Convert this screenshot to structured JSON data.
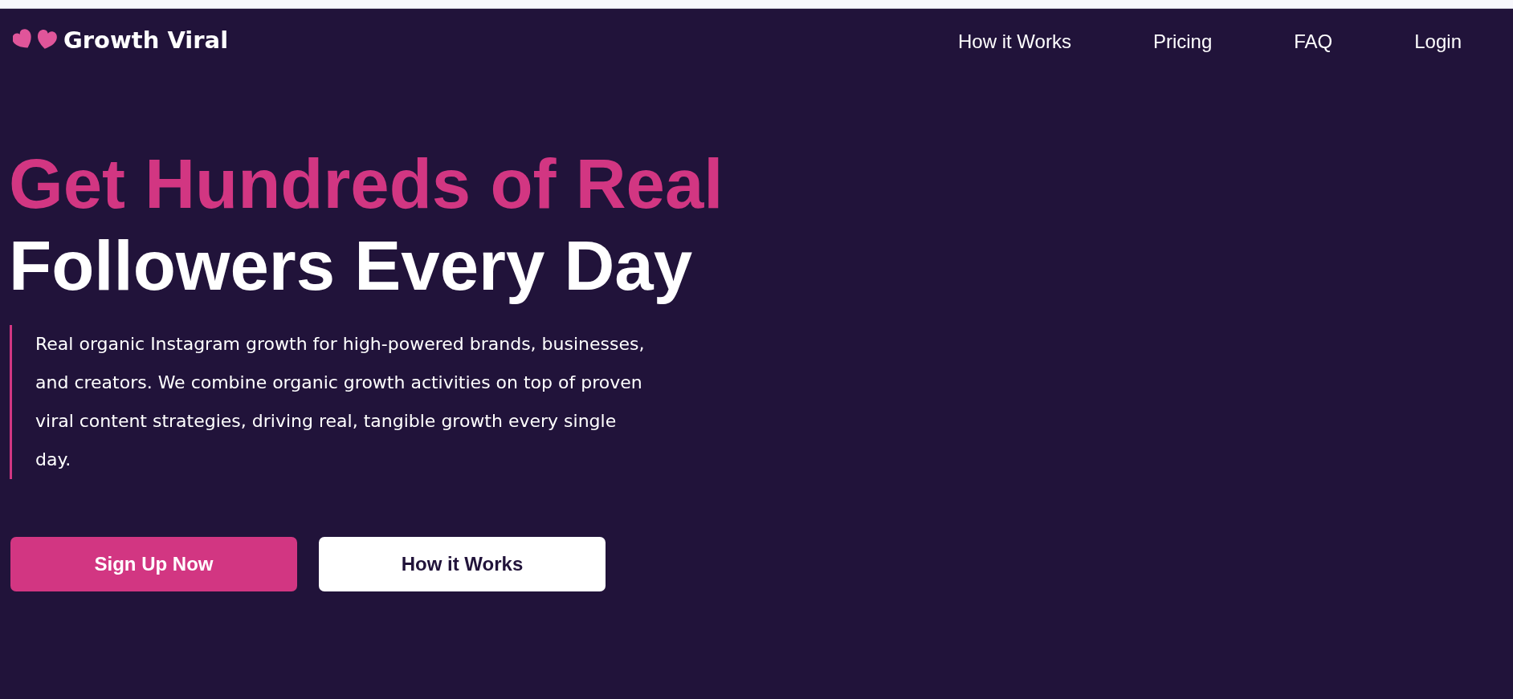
{
  "logo": {
    "text": "Growth Viral"
  },
  "nav": [
    "How it Works",
    "Pricing",
    "FAQ",
    "Login"
  ],
  "hero": {
    "headline": {
      "accent": "Get Hundreds of Real",
      "text": "Followers Every Day"
    },
    "description": "Real organic Instagram growth for high-powered brands, businesses, and creators. We combine organic growth activities on top of proven viral content strategies, driving real, tangible growth every single day.",
    "buttons": [
      {
        "label": "Sign Up Now",
        "kind": "primary"
      },
      {
        "label": "How it Works",
        "kind": "secondary"
      }
    ]
  }
}
